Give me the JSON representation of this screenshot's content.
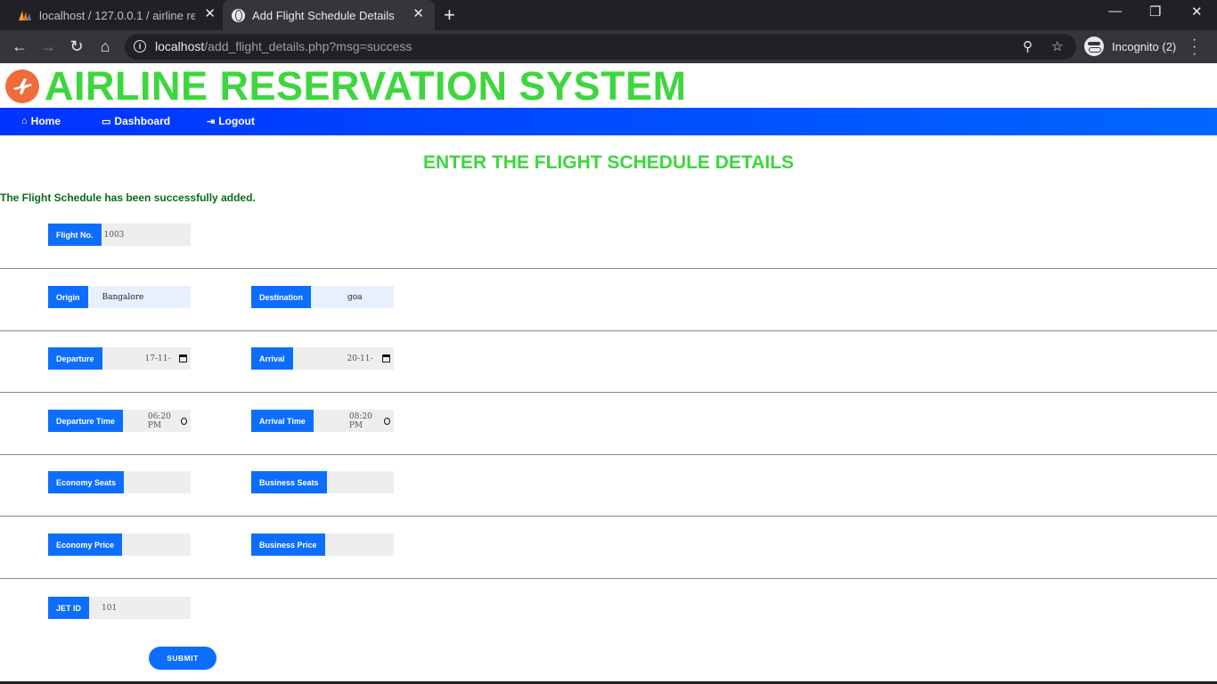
{
  "browser": {
    "tabs": [
      {
        "title": "localhost / 127.0.0.1 / airline rese",
        "active": false
      },
      {
        "title": "Add Flight Schedule Details",
        "active": true
      }
    ],
    "url_host": "localhost",
    "url_path": "/add_flight_details.php?msg=success",
    "profile_label": "Incognito (2)"
  },
  "site": {
    "title": "AIRLINE RESERVATION SYSTEM",
    "nav": [
      {
        "label": "Home",
        "icon": "home-icon"
      },
      {
        "label": "Dashboard",
        "icon": "monitor-icon"
      },
      {
        "label": "Logout",
        "icon": "logout-icon"
      }
    ]
  },
  "form": {
    "heading": "ENTER THE FLIGHT SCHEDULE DETAILS",
    "success_message": "The Flight Schedule has been successfully added.",
    "flight_no": {
      "label": "Flight No.",
      "value": "1003"
    },
    "origin": {
      "label": "Origin",
      "value": "Bangalore"
    },
    "destination": {
      "label": "Destination",
      "value": "goa"
    },
    "departure": {
      "label": "Departure",
      "value": "17-11-"
    },
    "arrival": {
      "label": "Arrival",
      "value": "20-11-"
    },
    "departure_time": {
      "label": "Departure Time",
      "value": "06:20 PM"
    },
    "arrival_time": {
      "label": "Arrival Time",
      "value": "08:20 PM"
    },
    "economy_seats": {
      "label": "Economy Seats",
      "value": ""
    },
    "business_seats": {
      "label": "Business Seats",
      "value": ""
    },
    "economy_price": {
      "label": "Economy Price",
      "value": ""
    },
    "business_price": {
      "label": "Business Price",
      "value": ""
    },
    "jet_id": {
      "label": "JET ID",
      "value": "101"
    },
    "submit_label": "SUBMIT"
  },
  "colors": {
    "title_green": "#3ed63e",
    "nav_blue": "#0033ff",
    "button_blue": "#0d6efd",
    "success_green": "#0b6b1c"
  }
}
